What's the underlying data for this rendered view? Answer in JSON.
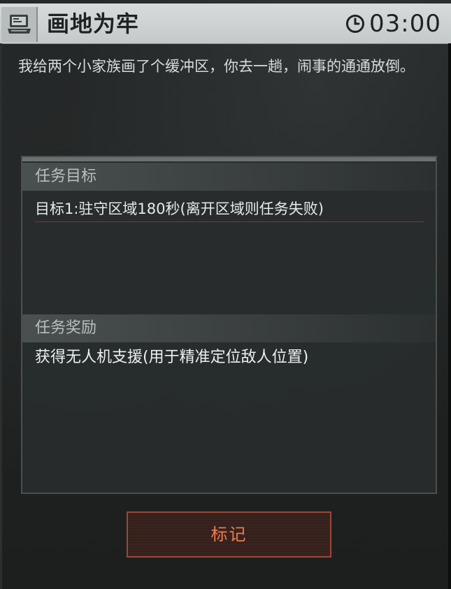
{
  "header": {
    "title": "画地为牢",
    "icon": "computer-terminal-icon",
    "timer_icon": "clock-icon",
    "timer": "03:00"
  },
  "description": "我给两个小家族画了个缓冲区，你去一趟，闹事的通通放倒。",
  "mission": {
    "objectives_header": "任务目标",
    "objective_1": "目标1:驻守区域180秒(离开区域则任务失败)",
    "rewards_header": "任务奖励",
    "reward_1": "获得无人机支援(用于精准定位敌人位置)"
  },
  "actions": {
    "mark_label": "标记"
  },
  "colors": {
    "accent": "#f07a4e",
    "button_border": "#9a4a35",
    "title_bar": "#d7dbdb"
  }
}
